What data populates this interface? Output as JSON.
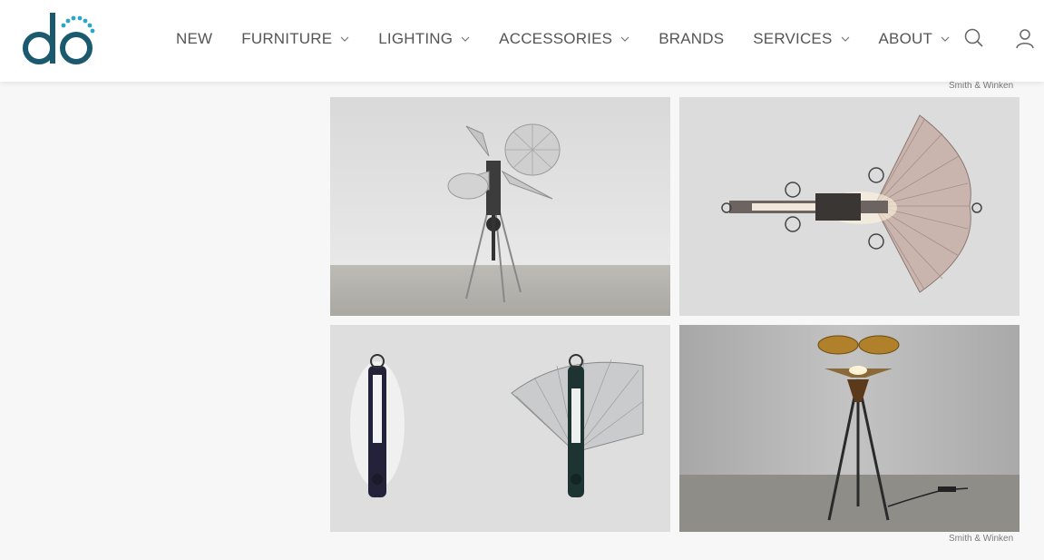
{
  "brand": {
    "logo_text": "dō",
    "logo_color": "#1b5a6e"
  },
  "nav": {
    "items": [
      {
        "label": "NEW",
        "has_dropdown": false
      },
      {
        "label": "FURNITURE",
        "has_dropdown": true
      },
      {
        "label": "LIGHTING",
        "has_dropdown": true
      },
      {
        "label": "ACCESSORIES",
        "has_dropdown": true
      },
      {
        "label": "BRANDS",
        "has_dropdown": false
      },
      {
        "label": "SERVICES",
        "has_dropdown": true
      },
      {
        "label": "ABOUT",
        "has_dropdown": true
      }
    ],
    "icons": [
      "search-icon",
      "user-icon"
    ]
  },
  "gallery": {
    "top_caption": "Smith & Winken",
    "bottom_caption": "Smith & Winken",
    "images": [
      {
        "name": "floor-lamp-fans-photo"
      },
      {
        "name": "wall-lamp-fan-photo"
      },
      {
        "name": "two-wall-lamps-photo"
      },
      {
        "name": "tripod-lamp-amber-photo"
      }
    ]
  },
  "colors": {
    "nav_text": "#555555",
    "page_bg": "#f7f7f7",
    "caption": "#7a7a7a"
  }
}
